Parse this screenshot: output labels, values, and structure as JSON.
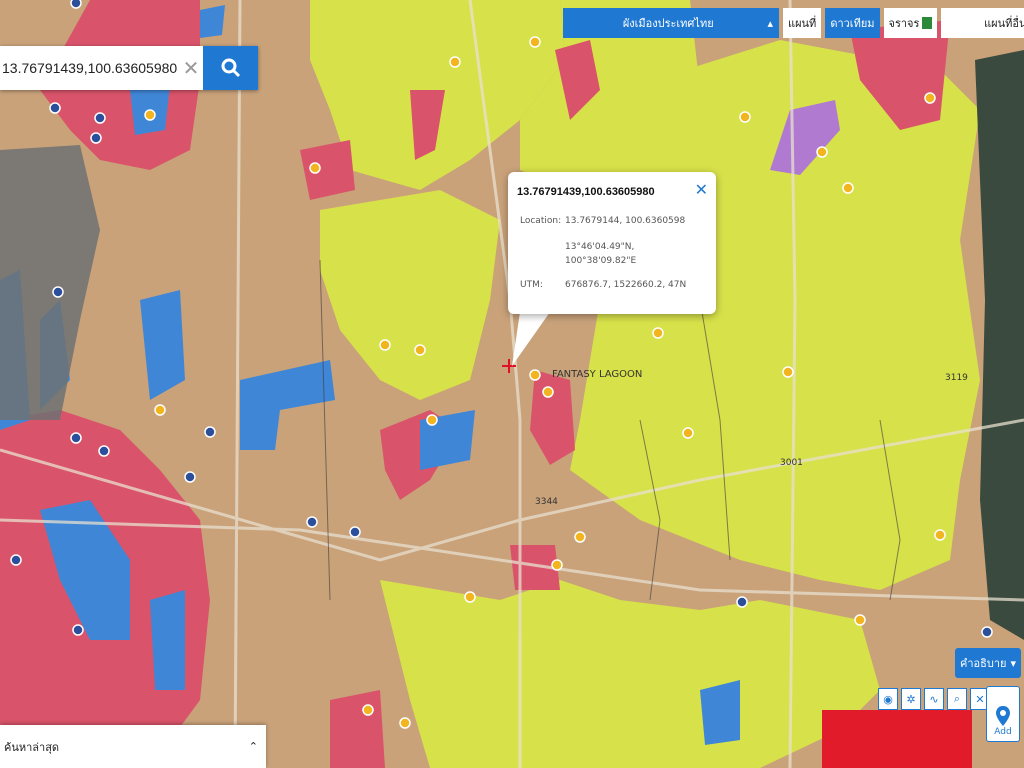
{
  "search": {
    "query": "13.76791439,100.63605980",
    "clear_icon": "close-icon",
    "button_icon": "search-icon"
  },
  "topbar": {
    "layer_select": "ผังเมืองประเทศไทย",
    "map_label": "แผนที่",
    "satellite_label": "ดาวเทียม",
    "traffic_label": "จราจร",
    "other_map_label": "แผนที่อื่นๆ"
  },
  "popup": {
    "title": "13.76791439,100.63605980",
    "location_label": "Location:",
    "location_value": "13.7679144, 100.6360598",
    "dms_lat": "13°46'04.49\"N,",
    "dms_lon": "100°38'09.82\"E",
    "utm_label": "UTM:",
    "utm_value": "676876.7, 1522660.2, 47N"
  },
  "map_labels": {
    "lagoon": "FANTASY LAGOON",
    "route_3344": "3344",
    "route_3119": "3119",
    "route_3001": "3001"
  },
  "legend_button": "คำอธิบาย",
  "tools": [
    "globe-icon",
    "target-icon",
    "line-icon",
    "measure-icon",
    "close-icon"
  ],
  "add_button": {
    "label": "Add",
    "icon": "map-pin-icon"
  },
  "recent": {
    "label": "ค้นหาล่าสุด",
    "icon": "chevron-double-icon"
  },
  "colors": {
    "residential_yellow": "#d7e14a",
    "commercial_red": "#d9546a",
    "rural_brown": "#c9a27a",
    "institution_blue": "#3f86d6",
    "accent": "#1f78d1",
    "purple": "#b07ad0"
  }
}
